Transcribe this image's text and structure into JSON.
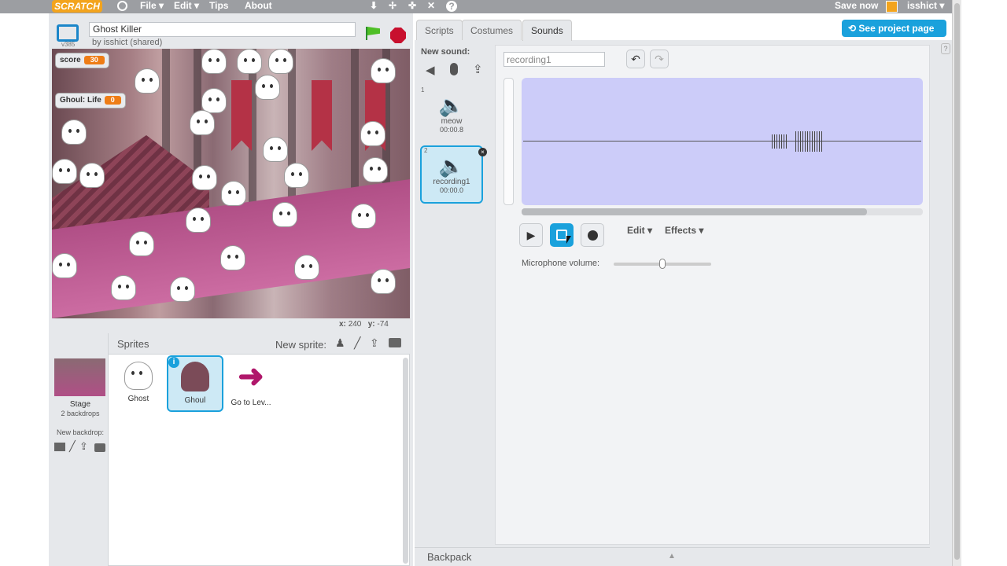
{
  "topbar": {
    "logo": "SCRATCH",
    "menu": [
      "File ▾",
      "Edit ▾",
      "Tips",
      "About"
    ],
    "save_now": "Save now",
    "user": "isshict ▾"
  },
  "project": {
    "title": "Ghost Killer",
    "byline": "by isshict (shared)",
    "version": "v385"
  },
  "monitors": [
    {
      "label": "score",
      "value": "30"
    },
    {
      "label": "Ghoul: Life",
      "value": "0"
    }
  ],
  "coords": {
    "x_label": "x:",
    "x": "240",
    "y_label": "y:",
    "y": "-74"
  },
  "sprites": {
    "header": "Sprites",
    "new_sprite": "New sprite:",
    "stage_label": "Stage",
    "stage_sub": "2 backdrops",
    "new_backdrop": "New backdrop:",
    "items": [
      "Ghost",
      "Ghoul",
      "Go to Lev..."
    ]
  },
  "tabs": [
    "Scripts",
    "Costumes",
    "Sounds"
  ],
  "see_project": "See project page",
  "new_sound": "New sound:",
  "sounds": [
    {
      "num": "1",
      "name": "meow",
      "dur": "00:00.8"
    },
    {
      "num": "2",
      "name": "recording1",
      "dur": "00:00.0"
    }
  ],
  "editor": {
    "name_value": "recording1",
    "edit_menu": "Edit ▾",
    "effects_menu": "Effects ▾",
    "mic_label": "Microphone volume:",
    "mic_volume": 0.5,
    "progress": 0.86
  },
  "backpack": "Backpack"
}
